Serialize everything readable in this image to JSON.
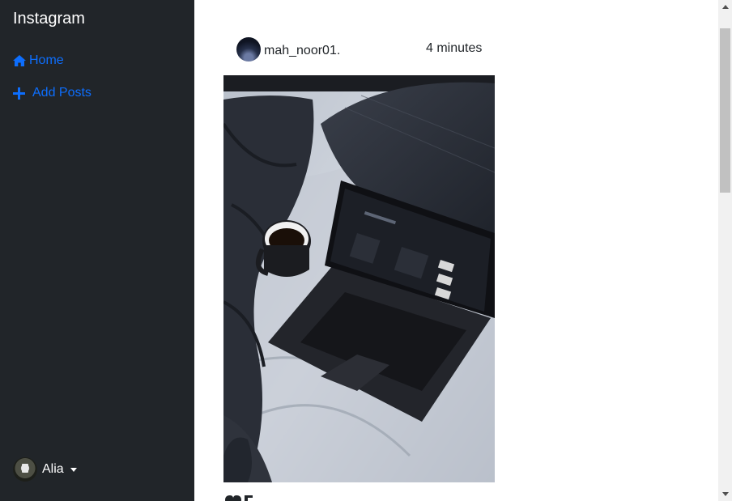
{
  "app": {
    "brand": "Instagram"
  },
  "sidebar": {
    "items": [
      {
        "label": "Home",
        "icon": "home-icon"
      },
      {
        "label": "Add Posts",
        "icon": "plus-icon"
      }
    ],
    "accent_color": "#0d6efd",
    "background": "#212529"
  },
  "user_menu": {
    "name": "Alia",
    "icon": "caret-down-icon"
  },
  "post": {
    "username": "mah_noor01.",
    "time": "4 minutes",
    "image_icon": "laptop-coffee-photo"
  }
}
